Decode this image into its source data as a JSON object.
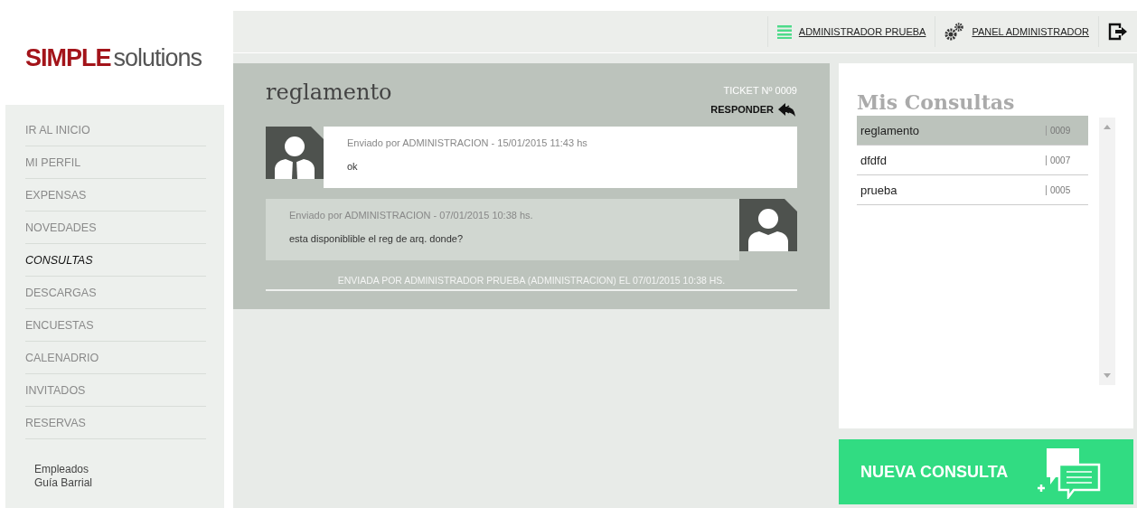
{
  "logo": {
    "brand": "SIMPLE",
    "suffix": "solutions"
  },
  "nav": [
    {
      "label": "IR AL INICIO",
      "selected": false
    },
    {
      "label": "MI PERFIL",
      "selected": false
    },
    {
      "label": "EXPENSAS",
      "selected": false
    },
    {
      "label": "NOVEDADES",
      "selected": false
    },
    {
      "label": "CONSULTAS",
      "selected": true
    },
    {
      "label": "DESCARGAS",
      "selected": false
    },
    {
      "label": "ENCUESTAS",
      "selected": false
    },
    {
      "label": "CALENADRIO",
      "selected": false
    },
    {
      "label": "INVITADOS",
      "selected": false
    },
    {
      "label": "RESERVAS",
      "selected": false
    }
  ],
  "sub_links": [
    "Empleados",
    "Guía Barrial"
  ],
  "topbar": {
    "user": "ADMINISTRADOR PRUEBA",
    "panel": "PANEL ADMINISTRADOR"
  },
  "ticket": {
    "title": "reglamento",
    "number": "TICKET Nº 0009",
    "reply": "RESPONDER",
    "messages": [
      {
        "kind": "incoming",
        "meta": "Enviado por ADMINISTRACION - 15/01/2015 11:43 hs",
        "text": "ok"
      },
      {
        "kind": "outgoing",
        "meta": "Enviado por ADMINISTRACION - 07/01/2015 10:38 hs.",
        "text": "esta disponiblible el reg de arq. donde?"
      }
    ],
    "footer": "ENVIADA POR ADMINISTRADOR PRUEBA (ADMINISTRACION) EL 07/01/2015 10:38 HS."
  },
  "consultas": {
    "title": "Mis Consultas",
    "items": [
      {
        "name": "reglamento",
        "number": "0009",
        "selected": true
      },
      {
        "name": "dfdfd",
        "number": "0007",
        "selected": false
      },
      {
        "name": "prueba",
        "number": "0005",
        "selected": false
      }
    ]
  },
  "new_button": "NUEVA CONSULTA"
}
